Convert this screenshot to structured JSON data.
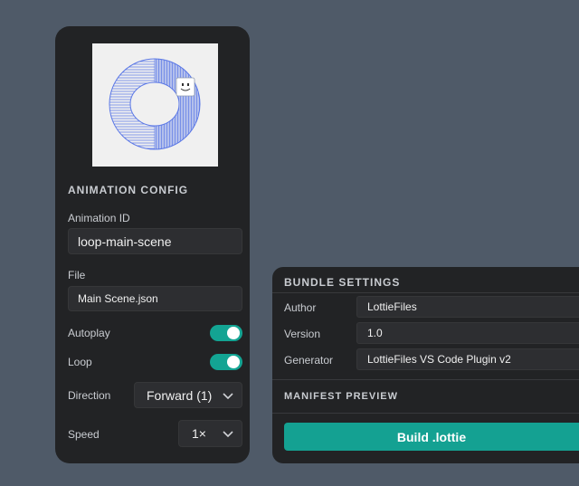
{
  "animation_config": {
    "title": "ANIMATION CONFIG",
    "animation_id": {
      "label": "Animation ID",
      "value": "loop-main-scene"
    },
    "file": {
      "label": "File",
      "value": "Main Scene.json"
    },
    "autoplay": {
      "label": "Autoplay",
      "enabled": true
    },
    "loop": {
      "label": "Loop",
      "enabled": true
    },
    "direction": {
      "label": "Direction",
      "value": "Forward (1)"
    },
    "speed": {
      "label": "Speed",
      "value": "1×"
    }
  },
  "bundle_settings": {
    "title": "BUNDLE SETTINGS",
    "author": {
      "label": "Author",
      "value": "LottieFiles"
    },
    "version": {
      "label": "Version",
      "value": "1.0"
    },
    "generator": {
      "label": "Generator",
      "value": "LottieFiles VS Code Plugin v2"
    }
  },
  "manifest_preview": {
    "title": "MANIFEST PREVIEW"
  },
  "build_button": {
    "label": "Build .lottie"
  },
  "colors": {
    "background": "#4f5a68",
    "panel": "#222325",
    "input": "#2d2e31",
    "accent": "#14a192",
    "preview_stroke": "#5b78e6"
  },
  "icons": {
    "preview": "loop-ring-animation-thumbnail",
    "smiley": "smiley-icon",
    "chevron": "chevron-down-icon"
  }
}
